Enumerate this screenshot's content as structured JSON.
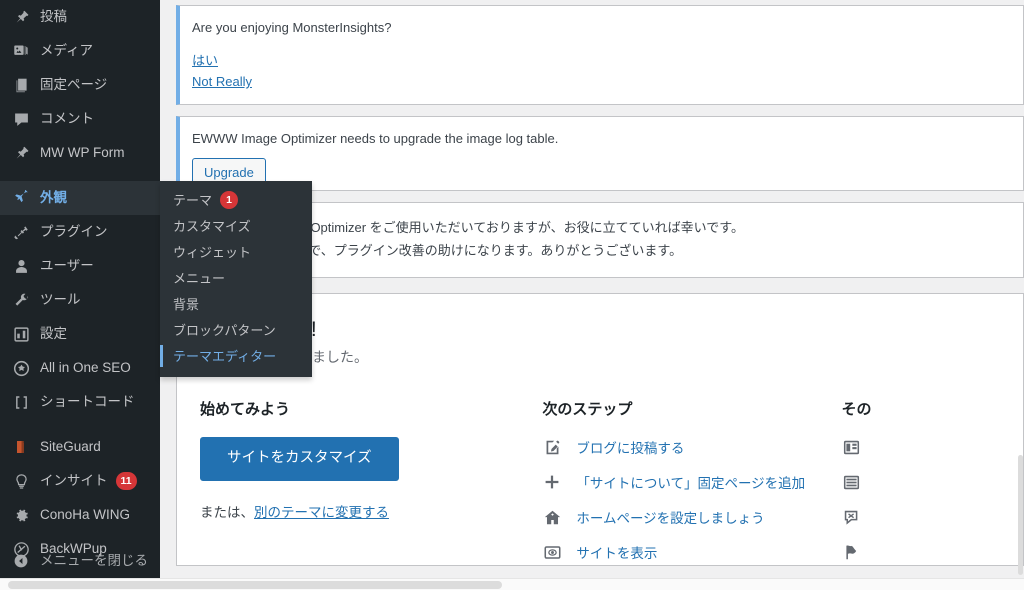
{
  "sidebar": {
    "items": [
      {
        "label": "投稿",
        "icon": "pin-icon",
        "state": "normal"
      },
      {
        "label": "メディア",
        "icon": "media-icon",
        "state": "normal"
      },
      {
        "label": "固定ページ",
        "icon": "pages-icon",
        "state": "normal"
      },
      {
        "label": "コメント",
        "icon": "comment-icon",
        "state": "normal"
      },
      {
        "label": "MW WP Form",
        "icon": "pin-icon",
        "state": "normal"
      },
      {
        "label": "外観",
        "icon": "appearance-icon",
        "state": "current"
      },
      {
        "label": "プラグイン",
        "icon": "plugin-icon",
        "state": "normal"
      },
      {
        "label": "ユーザー",
        "icon": "user-icon",
        "state": "normal"
      },
      {
        "label": "ツール",
        "icon": "tools-icon",
        "state": "normal"
      },
      {
        "label": "設定",
        "icon": "settings-icon",
        "state": "normal"
      },
      {
        "label": "All in One SEO",
        "icon": "aioseo-icon",
        "state": "normal"
      },
      {
        "label": "ショートコード",
        "icon": "shortcode-icon",
        "state": "normal"
      },
      {
        "label": "SiteGuard",
        "icon": "siteguard-icon",
        "state": "normal"
      },
      {
        "label": "インサイト",
        "icon": "insights-icon",
        "state": "normal",
        "badge": "11"
      },
      {
        "label": "ConoHa WING",
        "icon": "gear-icon",
        "state": "normal"
      },
      {
        "label": "BackWPup",
        "icon": "backwpup-icon",
        "state": "normal"
      }
    ],
    "collapse_label": "メニューを閉じる",
    "collapse_icon": "collapse-arrow-icon"
  },
  "flyout": {
    "parent": "外観",
    "items": [
      {
        "label": "テーマ",
        "badge": "1",
        "state": "normal"
      },
      {
        "label": "カスタマイズ",
        "state": "normal"
      },
      {
        "label": "ウィジェット",
        "state": "normal"
      },
      {
        "label": "メニュー",
        "state": "normal"
      },
      {
        "label": "背景",
        "state": "normal"
      },
      {
        "label": "ブロックパターン",
        "state": "normal"
      },
      {
        "label": "テーマエディター",
        "state": "current"
      }
    ]
  },
  "notices": {
    "monsterinsights": {
      "text": "Are you enjoying MonsterInsights?",
      "link_yes": "はい",
      "link_no": "Not Really"
    },
    "ewww_upgrade": {
      "text": "EWWW Image Optimizer needs to upgrade the image log table.",
      "button": "Upgrade"
    },
    "ewww_review": {
      "line1": "の間 EWWW Image Optimizer をご使用いただいておりますが、お役に立てていれば幸いです。",
      "line2": "価していただくことで、プラグイン改善の助けになります。ありがとうございます。"
    }
  },
  "welcome": {
    "heading": "へようこそ !",
    "subtext": "別なリンクを集めました。",
    "columns": {
      "start": {
        "title": "始めてみよう",
        "primary_button": "サイトをカスタマイズ",
        "or_prefix": "または、",
        "or_link": "別のテーマに変更する"
      },
      "next_steps": {
        "title": "次のステップ",
        "items": [
          {
            "label": "ブログに投稿する",
            "icon": "write-post-icon"
          },
          {
            "label": "「サイトについて」固定ページを追加",
            "icon": "plus-icon"
          },
          {
            "label": "ホームページを設定しましょう",
            "icon": "home-icon"
          },
          {
            "label": "サイトを表示",
            "icon": "view-site-icon"
          }
        ]
      },
      "more": {
        "title": "その",
        "items": [
          {
            "label": "",
            "icon": "widgets-icon"
          },
          {
            "label": "",
            "icon": "menus-icon"
          },
          {
            "label": "",
            "icon": "comments-off-icon"
          },
          {
            "label": "",
            "icon": "flag-icon"
          }
        ]
      }
    }
  },
  "colors": {
    "sidebar_bg": "#1d2327",
    "flyout_bg": "#2c3338",
    "accent_blue": "#2271b1",
    "highlight_blue": "#72aee6",
    "badge_red": "#d63638",
    "content_bg": "#f0f0f1"
  }
}
